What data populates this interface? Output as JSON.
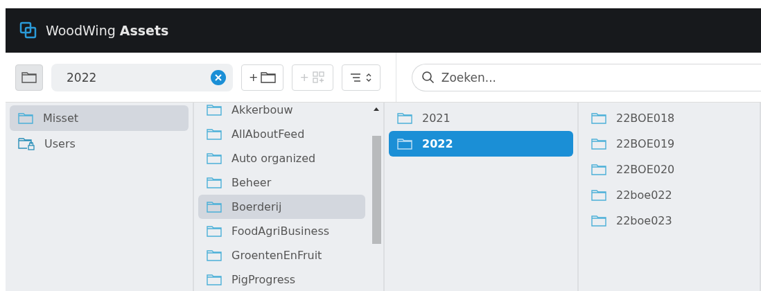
{
  "header": {
    "title": "WoodWing **Assets**"
  },
  "toolbar": {
    "path_field": {
      "value": "2022"
    },
    "buttons": [
      {
        "kind": "new_folder",
        "label": "+",
        "disabled": false
      },
      {
        "kind": "new_collection",
        "label": "+",
        "disabled": true
      },
      {
        "kind": "sort",
        "disabled": false
      }
    ],
    "search": {
      "placeholder": "Zoeken..."
    }
  },
  "columns": [
    {
      "items": [
        {
          "kind": "folder",
          "label": "Misset",
          "selected": true,
          "focused": false
        },
        {
          "kind": "users",
          "label": "Users",
          "selected": false,
          "focused": false
        }
      ]
    },
    {
      "scrollbar": true,
      "items": [
        {
          "kind": "folder",
          "label": "Akkerbouw",
          "selected": false,
          "focused": false
        },
        {
          "kind": "folder",
          "label": "AllAboutFeed",
          "selected": false,
          "focused": false
        },
        {
          "kind": "folder",
          "label": "Auto organized",
          "selected": false,
          "focused": false
        },
        {
          "kind": "folder",
          "label": "Beheer",
          "selected": false,
          "focused": false
        },
        {
          "kind": "folder",
          "label": "Boerderij",
          "selected": true,
          "focused": false
        },
        {
          "kind": "folder",
          "label": "FoodAgriBusiness",
          "selected": false,
          "focused": false
        },
        {
          "kind": "folder",
          "label": "GroentenEnFruit",
          "selected": false,
          "focused": false
        },
        {
          "kind": "folder",
          "label": "PigProgress",
          "selected": false,
          "focused": false
        }
      ]
    },
    {
      "items": [
        {
          "kind": "folder",
          "label": "2021",
          "selected": false,
          "focused": false
        },
        {
          "kind": "folder",
          "label": "2022",
          "selected": true,
          "focused": true
        }
      ]
    },
    {
      "items": [
        {
          "kind": "folder",
          "label": "22BOE018",
          "selected": false,
          "focused": false
        },
        {
          "kind": "folder",
          "label": "22BOE019",
          "selected": false,
          "focused": false
        },
        {
          "kind": "folder",
          "label": "22BOE020",
          "selected": false,
          "focused": false
        },
        {
          "kind": "folder",
          "label": "22boe022",
          "selected": false,
          "focused": false
        },
        {
          "kind": "folder",
          "label": "22boe023",
          "selected": false,
          "focused": false
        }
      ]
    }
  ]
}
